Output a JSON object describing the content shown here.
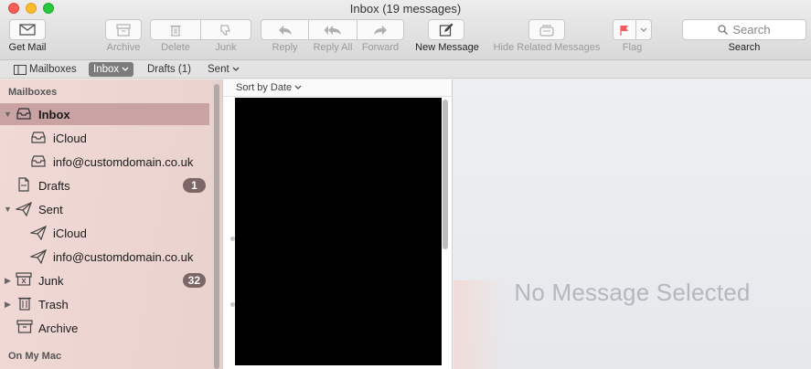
{
  "window": {
    "title": "Inbox (19 messages)"
  },
  "toolbar": {
    "get_mail": "Get Mail",
    "archive": "Archive",
    "delete": "Delete",
    "junk": "Junk",
    "reply": "Reply",
    "reply_all": "Reply All",
    "forward": "Forward",
    "new_message": "New Message",
    "hide_related": "Hide Related Messages",
    "flag": "Flag",
    "search_placeholder": "Search",
    "search_label": "Search"
  },
  "favorites_bar": {
    "mailboxes": "Mailboxes",
    "inbox": "Inbox",
    "drafts": "Drafts (1)",
    "sent": "Sent"
  },
  "sidebar": {
    "header": "Mailboxes",
    "on_my_mac": "On My Mac",
    "items": [
      {
        "label": "Inbox",
        "icon": "inbox-icon"
      },
      {
        "label": "iCloud",
        "icon": "inbox-icon"
      },
      {
        "label": "info@customdomain.co.uk",
        "icon": "inbox-icon"
      },
      {
        "label": "Drafts",
        "icon": "drafts-icon",
        "badge": "1"
      },
      {
        "label": "Sent",
        "icon": "sent-icon"
      },
      {
        "label": "iCloud",
        "icon": "sent-icon"
      },
      {
        "label": "info@customdomain.co.uk",
        "icon": "sent-icon"
      },
      {
        "label": "Junk",
        "icon": "junk-icon",
        "badge": "32"
      },
      {
        "label": "Trash",
        "icon": "trash-icon"
      },
      {
        "label": "Archive",
        "icon": "archive-icon"
      }
    ]
  },
  "message_list": {
    "sort_label": "Sort by Date"
  },
  "preview": {
    "empty_text": "No Message Selected"
  },
  "colors": {
    "selected_row": "#c9a3a3",
    "badge": "#7d6766",
    "flag": "#f15b5b"
  }
}
